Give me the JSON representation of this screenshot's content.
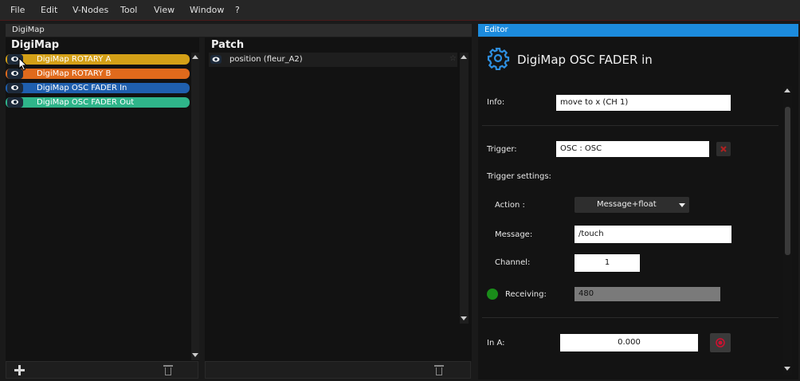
{
  "menu": [
    "File",
    "Edit",
    "V-Nodes",
    "Tool",
    "View",
    "Window",
    "?"
  ],
  "digimap_panel": {
    "tab_label": "DigiMap",
    "title": "DigiMap",
    "items": [
      {
        "label": "DigiMap ROTARY A",
        "color": "#d4a017"
      },
      {
        "label": "DigiMap ROTARY B",
        "color": "#e06a1c"
      },
      {
        "label": "DigiMap OSC FADER In",
        "color": "#1f5fae"
      },
      {
        "label": "DigiMap OSC FADER Out",
        "color": "#2fb58a"
      }
    ]
  },
  "patch_panel": {
    "title": "Patch",
    "items": [
      {
        "label": "position (fleur_A2)"
      }
    ]
  },
  "editor": {
    "tab_label": "Editor",
    "title": "DigiMap OSC FADER in",
    "info_label": "Info:",
    "info_value": "move to x (CH 1)",
    "trigger_label": "Trigger:",
    "trigger_value": "OSC : OSC",
    "trigger_settings_label": "Trigger settings:",
    "action_label": "Action :",
    "action_value": "Message+float",
    "message_label": "Message:",
    "message_value": "/touch",
    "channel_label": "Channel:",
    "channel_value": "1",
    "receiving_label": "Receiving:",
    "receiving_value": "480",
    "receiving_status_color": "#1a8c1a",
    "in_a_label": "In A:",
    "in_a_value": "0.000"
  },
  "colors": {
    "accent": "#1c8bdd",
    "record": "#d01030",
    "clear": "#b02020"
  }
}
